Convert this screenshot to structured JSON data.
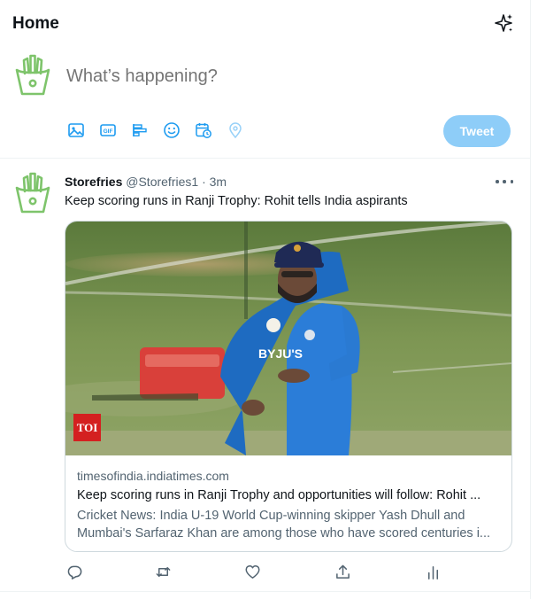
{
  "header": {
    "title": "Home",
    "icon": "sparkle-icon"
  },
  "composer": {
    "avatar_icon": "fries-avatar-icon",
    "placeholder": "What’s happening?",
    "tools": [
      "image-icon",
      "gif-icon",
      "poll-icon",
      "emoji-icon",
      "schedule-icon",
      "location-icon"
    ],
    "tweet_button": "Tweet",
    "accent": "#1d9bf0",
    "button_color": "#8ecdf8"
  },
  "tweet": {
    "name": "Storefries",
    "handle": "@Storefries1",
    "separator": "·",
    "time": "3m",
    "text": "Keep scoring runs in Ranji Trophy: Rohit tells India aspirants",
    "card": {
      "badge": "TOI",
      "domain": "timesofindia.indiatimes.com",
      "title": "Keep scoring runs in Ranji Trophy and opportunities will follow: Rohit ...",
      "description_line1": "Cricket News: India U-19 World Cup-winning skipper Yash Dhull and",
      "description_line2": "Mumbai's Sarfaraz Khan are among those who have scored centuries i..."
    },
    "actions": [
      "reply-icon",
      "retweet-icon",
      "like-icon",
      "share-icon",
      "analytics-icon"
    ]
  }
}
